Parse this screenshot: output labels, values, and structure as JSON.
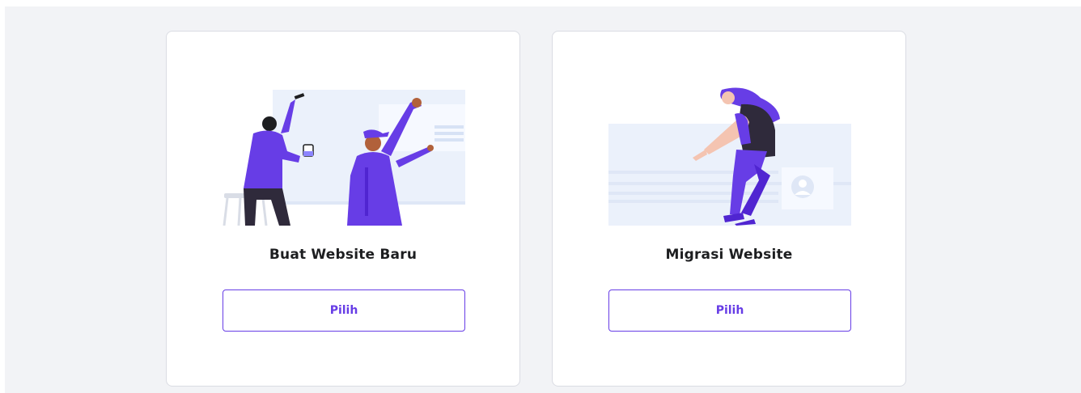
{
  "options": [
    {
      "illustration": "builders-painting-wall-illustration",
      "title": "Buat Website Baru",
      "button_label": "Pilih"
    },
    {
      "illustration": "woman-migrating-website-illustration",
      "title": "Migrasi Website",
      "button_label": "Pilih"
    }
  ],
  "colors": {
    "accent": "#673de6",
    "page_background": "#f2f3f6",
    "card_background": "#ffffff",
    "title_text": "#1d1e20",
    "illustration_panel": "#ebf1fb"
  }
}
